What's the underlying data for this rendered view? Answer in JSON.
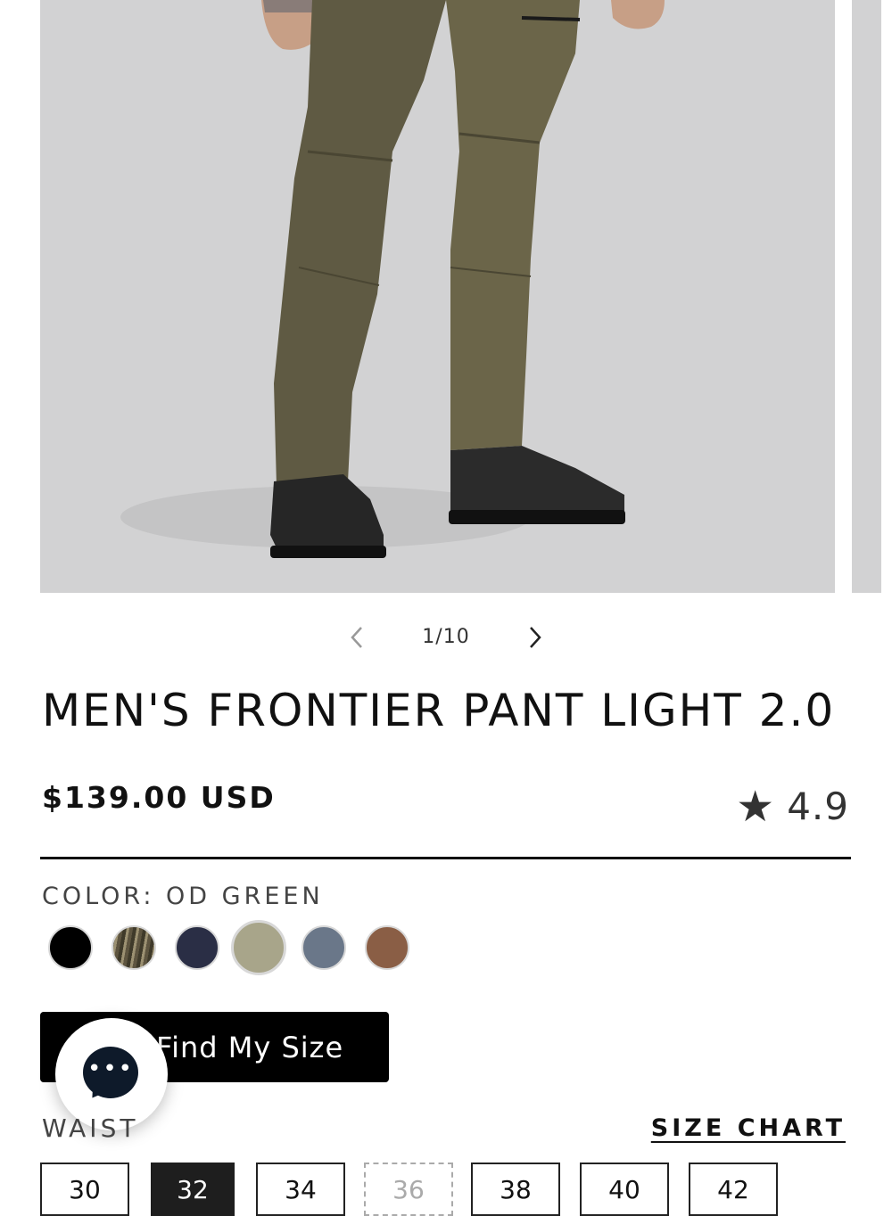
{
  "gallery": {
    "counter": "1/10",
    "image_background": "#d2d2d3",
    "prev_icon": "chevron-left-icon",
    "next_icon": "chevron-right-icon"
  },
  "product": {
    "title": "MEN'S FRONTIER PANT LIGHT 2.0",
    "price": "$139.00 USD",
    "rating": "4.9",
    "rating_icon": "star-icon"
  },
  "color": {
    "label": "COLOR: OD GREEN",
    "swatches": [
      {
        "name": "black",
        "hex": "#000000",
        "selected": false
      },
      {
        "name": "camo",
        "hex": "#6b5f45",
        "selected": false
      },
      {
        "name": "navy",
        "hex": "#2a2e45",
        "selected": false
      },
      {
        "name": "od-green",
        "hex": "#a8a58a",
        "selected": true
      },
      {
        "name": "slate-blue",
        "hex": "#6a7789",
        "selected": false
      },
      {
        "name": "brown",
        "hex": "#8a5e45",
        "selected": false
      }
    ]
  },
  "find_size": {
    "label": "Find My Size"
  },
  "chat": {
    "icon": "chat-bubble-icon",
    "dots": "•••"
  },
  "waist": {
    "label": "WAIST",
    "size_chart_label": "SIZE CHART",
    "sizes": [
      {
        "label": "30",
        "state": "available"
      },
      {
        "label": "32",
        "state": "selected"
      },
      {
        "label": "34",
        "state": "available"
      },
      {
        "label": "36",
        "state": "unavailable"
      },
      {
        "label": "38",
        "state": "available"
      },
      {
        "label": "40",
        "state": "available"
      },
      {
        "label": "42",
        "state": "available"
      }
    ]
  }
}
